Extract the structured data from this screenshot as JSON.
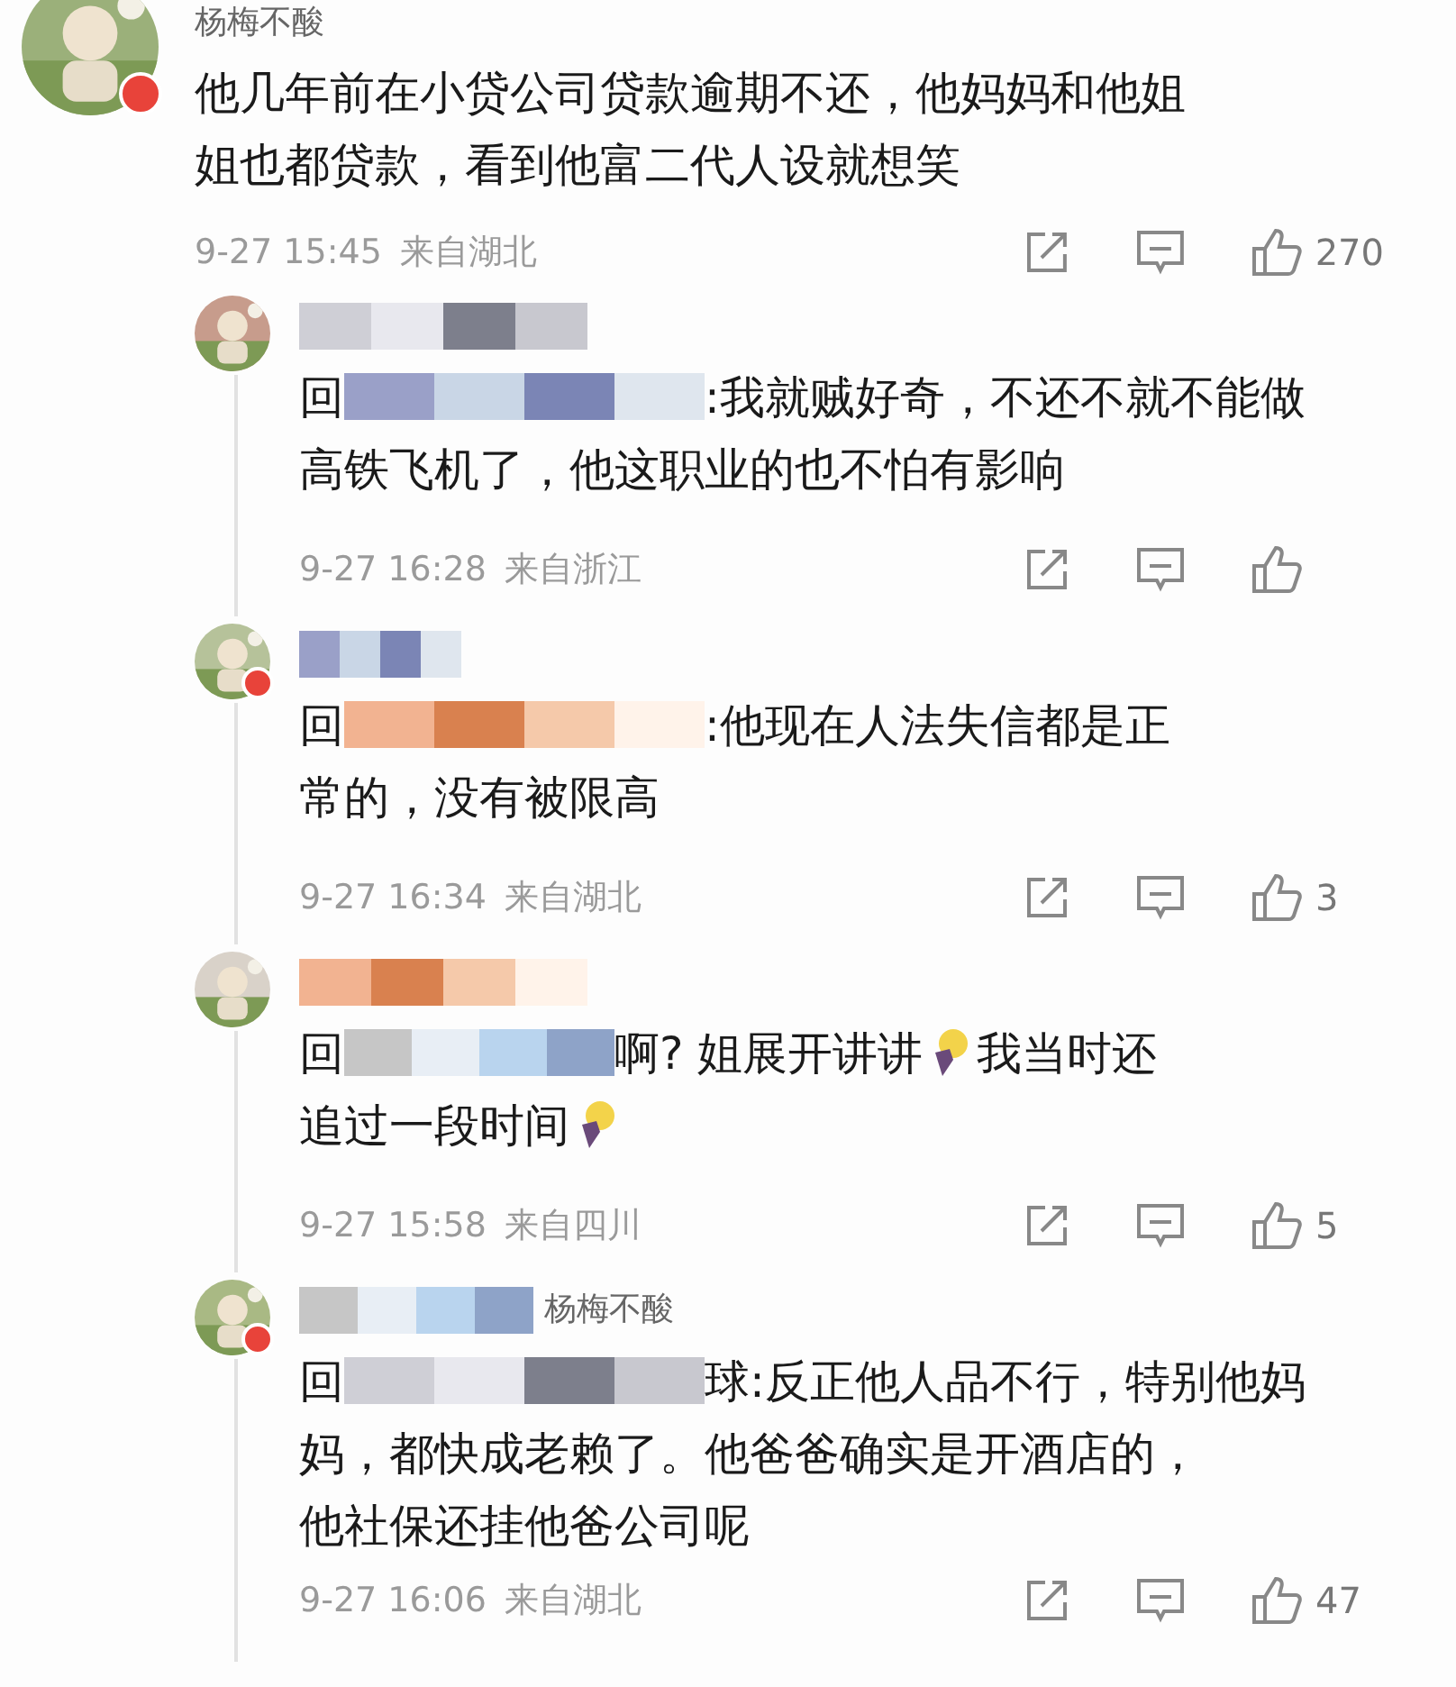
{
  "comment": {
    "author": "杨梅不酸",
    "badge": true,
    "text": "他几年前在小贷公司贷款逾期不还，他妈妈和他姐姐也都贷款，看到他富二代人设就想笑",
    "time": "9-27 15:45",
    "location": "来自湖北",
    "likes": "270"
  },
  "replies": [
    {
      "badge": false,
      "prefix": "回",
      "lines": [
        [
          {
            "kind": "text",
            "text": ":我就贼好奇，不还不就不能做"
          }
        ],
        [
          {
            "kind": "text",
            "text": "高铁飞机了，他这职业的也不怕有影响"
          }
        ]
      ],
      "time": "9-27 16:28",
      "location": "来自浙江"
    },
    {
      "badge": true,
      "prefix": "回",
      "lines": [
        [
          {
            "kind": "text",
            "text": ":他现在人法失信都是正"
          }
        ],
        [
          {
            "kind": "text",
            "text": "常的，没有被限高"
          }
        ]
      ],
      "time": "9-27 16:34",
      "location": "来自湖北",
      "likes": "3"
    },
    {
      "badge": false,
      "prefix": "回",
      "lines": [
        [
          {
            "kind": "text",
            "text": "啊? 姐展开讲讲"
          },
          {
            "kind": "icon"
          },
          {
            "kind": "text",
            "text": "我当时还"
          }
        ],
        [
          {
            "kind": "text",
            "text": "追过一段时间"
          },
          {
            "kind": "icon"
          }
        ]
      ],
      "time": "9-27 15:58",
      "location": "来自四川",
      "likes": "5"
    },
    {
      "badge": true,
      "author": "杨梅不酸",
      "prefix": "回",
      "lines": [
        [
          {
            "kind": "text",
            "text": "球:反正他人品不行，特别他妈"
          }
        ],
        [
          {
            "kind": "text",
            "text": "妈，都快成老赖了。他爸爸确实是开酒店的，"
          }
        ],
        [
          {
            "kind": "text",
            "text": "他社保还挂他爸公司呢"
          }
        ]
      ],
      "time": "9-27 16:06",
      "location": "来自湖北",
      "likes": "47"
    }
  ]
}
